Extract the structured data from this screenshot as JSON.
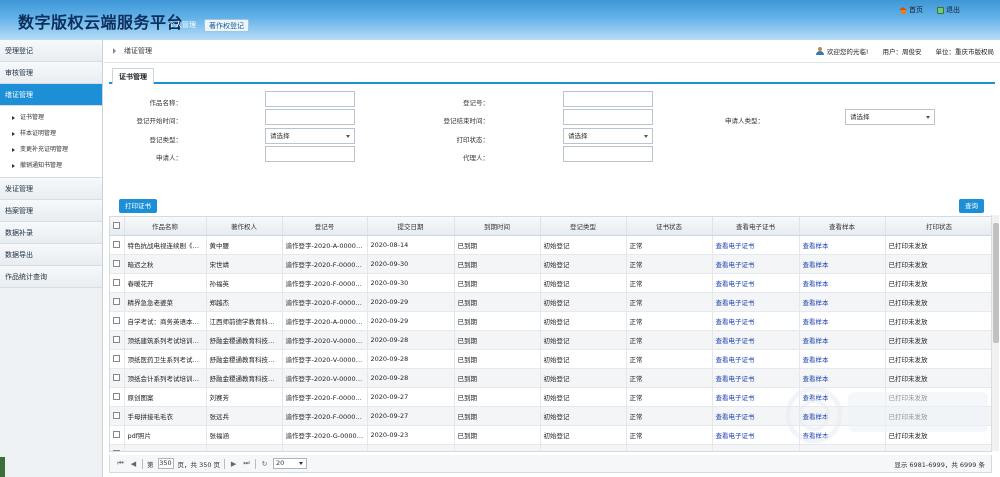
{
  "header": {
    "title": "数字版权云端服务平台",
    "nav": [
      {
        "label": "个人管理"
      },
      {
        "label": "著作权登记"
      }
    ],
    "home_label": "首页",
    "exit_label": "退出"
  },
  "sidebar": {
    "items": [
      {
        "label": "受理登记"
      },
      {
        "label": "审核管理"
      },
      {
        "label": "缮证管理"
      },
      {
        "label": "发证管理"
      },
      {
        "label": "档案管理"
      },
      {
        "label": "数据补录"
      },
      {
        "label": "数据导出"
      },
      {
        "label": "作品统计查询"
      }
    ],
    "subitems": [
      {
        "label": "证书管理"
      },
      {
        "label": "样本证明管理"
      },
      {
        "label": "变更补充证明管理"
      },
      {
        "label": "撤销通知书管理"
      }
    ]
  },
  "breadcrumb": "缮证管理",
  "welcome": {
    "greeting": "欢迎您的光临!",
    "user": "用户：周俊安",
    "unit": "单位：重庆市版权局"
  },
  "tab": "证书管理",
  "form": {
    "work_name": "作品名称：",
    "reg_no": "登记号：",
    "reg_start": "登记开始时间：",
    "reg_end": "登记结束时间：",
    "applicant_type": "申请人类型：",
    "applicant_type_value": "请选择",
    "reg_type": "登记类型：",
    "reg_type_value": "请选择",
    "print_status": "打印状态：",
    "print_status_value": "请选择",
    "applicant": "申请人：",
    "agent": "代理人："
  },
  "buttons": {
    "print": "打印证书",
    "query": "查询"
  },
  "table": {
    "columns": [
      "作品名称",
      "著作权人",
      "登记号",
      "提交日期",
      "到期时间",
      "登记类型",
      "证书状态",
      "查看电子证书",
      "查看样本",
      "打印状态"
    ],
    "rows": [
      {
        "name": "特色抗战电视连续剧《神枪…",
        "owner": "黄中腰",
        "regno": "渝作登字-2020-A-000000…",
        "date": "2020-08-14",
        "expire": "已到期",
        "type": "初始登记",
        "status": "正常",
        "cert": "查看电子证书",
        "sample": "查看样本",
        "print": "已打印未发放"
      },
      {
        "name": "暗迟之秋",
        "owner": "宋世靖",
        "regno": "渝作登字-2020-F-00000025",
        "date": "2020-09-30",
        "expire": "已到期",
        "type": "初始登记",
        "status": "正常",
        "cert": "查看电子证书",
        "sample": "查看样本",
        "print": "已打印未发放"
      },
      {
        "name": "春暖花开",
        "owner": "孙福英",
        "regno": "渝作登字-2020-F-00000022",
        "date": "2020-09-30",
        "expire": "已到期",
        "type": "初始登记",
        "status": "正常",
        "cert": "查看电子证书",
        "sample": "查看样本",
        "print": "已打印未发放"
      },
      {
        "name": "精界急急老婆菜",
        "owner": "郑越杰",
        "regno": "渝作登字-2020-F-00000021",
        "date": "2020-09-29",
        "expire": "已到期",
        "type": "初始登记",
        "status": "正常",
        "cert": "查看电子证书",
        "sample": "查看样本",
        "print": "已打印未发放"
      },
      {
        "name": "自学考试：商务英语本科段",
        "owner": "江西师前德学教育科技有限…",
        "regno": "渝作登字-2020-A-000000…",
        "date": "2020-09-29",
        "expire": "已到期",
        "type": "初始登记",
        "status": "正常",
        "cert": "查看电子证书",
        "sample": "查看样本",
        "print": "已打印未发放"
      },
      {
        "name": "顶纸建筑系列考试培训视…",
        "owner": "舒融金稷通教育科技有限公…",
        "regno": "渝作登字-2020-V-000000…",
        "date": "2020-09-28",
        "expire": "已到期",
        "type": "初始登记",
        "status": "正常",
        "cert": "查看电子证书",
        "sample": "查看样本",
        "print": "已打印未发放"
      },
      {
        "name": "顶纸医药卫生系列考试培训…",
        "owner": "舒融金稷通教育科技有限公…",
        "regno": "渝作登字-2020-V-000000…",
        "date": "2020-09-28",
        "expire": "已到期",
        "type": "初始登记",
        "status": "正常",
        "cert": "查看电子证书",
        "sample": "查看样本",
        "print": "已打印未发放"
      },
      {
        "name": "顶纸会计系列考试培训视…",
        "owner": "舒融金稷通教育科技有限公…",
        "regno": "渝作登字-2020-V-000000…",
        "date": "2020-09-28",
        "expire": "已到期",
        "type": "初始登记",
        "status": "正常",
        "cert": "查看电子证书",
        "sample": "查看样本",
        "print": "已打印未发放"
      },
      {
        "name": "原创图案",
        "owner": "刘赛芳",
        "regno": "渝作登字-2020-F-00000016",
        "date": "2020-09-27",
        "expire": "已到期",
        "type": "初始登记",
        "status": "正常",
        "cert": "查看电子证书",
        "sample": "查看样本",
        "print": "已打印未发放"
      },
      {
        "name": "手母拼接毛毛衣",
        "owner": "张远兵",
        "regno": "渝作登字-2020-F-00000015",
        "date": "2020-09-27",
        "expire": "已到期",
        "type": "初始登记",
        "status": "正常",
        "cert": "查看电子证书",
        "sample": "查看样本",
        "print": "已打印未发放"
      },
      {
        "name": "pdf照片",
        "owner": "张福涵",
        "regno": "渝作登字-2020-G-000000…",
        "date": "2020-09-23",
        "expire": "已到期",
        "type": "初始登记",
        "status": "正常",
        "cert": "查看电子证书",
        "sample": "查看样本",
        "print": "已打印未发放"
      },
      {
        "name": "5000000",
        "owner": "张福涵",
        "regno": "渝作登字-2020-G-000000…",
        "date": "2020-09-23",
        "expire": "已到期",
        "type": "初始登记",
        "status": "正常",
        "cert": "查看电子证书",
        "sample": "查看样本",
        "print": "已打印未发放"
      }
    ]
  },
  "pager": {
    "page_prefix": "第",
    "page": "350",
    "page_suffix": "页，共 350 页",
    "page_size": "20",
    "info": "显示 6981-6999，共 6999 条"
  }
}
